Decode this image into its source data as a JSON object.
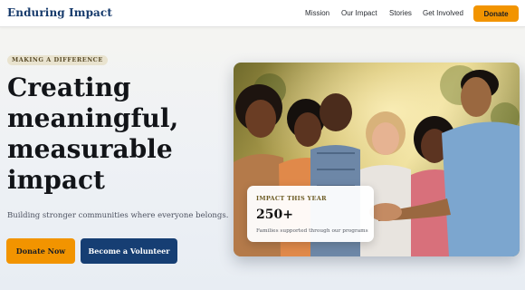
{
  "header": {
    "logo": "Enduring Impact",
    "nav": [
      {
        "label": "Mission"
      },
      {
        "label": "Our Impact"
      },
      {
        "label": "Stories"
      },
      {
        "label": "Get Involved"
      }
    ],
    "donate_label": "Donate"
  },
  "hero": {
    "badge": "MAKING A DIFFERENCE",
    "headline": "Creating meaningful, measurable impact",
    "subtitle": "Building stronger communities where everyone belongs.",
    "primary_cta": "Donate Now",
    "secondary_cta": "Become a Volunteer"
  },
  "impact_card": {
    "label": "IMPACT THIS YEAR",
    "number": "250+",
    "description": "Families supported through our programs"
  },
  "colors": {
    "brand_navy": "#163e73",
    "accent_orange": "#f29400",
    "badge_bg": "#e9e3cf"
  }
}
